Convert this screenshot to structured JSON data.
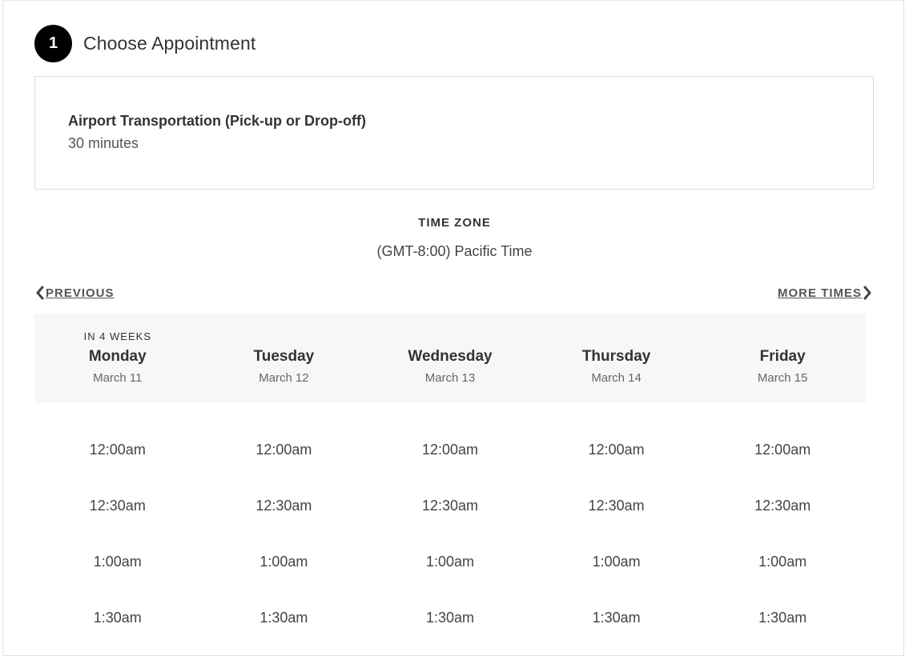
{
  "step": {
    "number": "1",
    "title": "Choose Appointment"
  },
  "service": {
    "name": "Airport Transportation (Pick-up or Drop-off)",
    "duration": "30 minutes"
  },
  "timezone": {
    "label": "TIME ZONE",
    "value": "(GMT-8:00) Pacific Time"
  },
  "nav": {
    "previous": "PREVIOUS",
    "more": "MORE TIMES"
  },
  "week_note": "IN 4 WEEKS",
  "days": [
    {
      "name": "Monday",
      "date": "March 11"
    },
    {
      "name": "Tuesday",
      "date": "March 12"
    },
    {
      "name": "Wednesday",
      "date": "March 13"
    },
    {
      "name": "Thursday",
      "date": "March 14"
    },
    {
      "name": "Friday",
      "date": "March 15"
    }
  ],
  "time_rows": [
    [
      "12:00am",
      "12:00am",
      "12:00am",
      "12:00am",
      "12:00am"
    ],
    [
      "12:30am",
      "12:30am",
      "12:30am",
      "12:30am",
      "12:30am"
    ],
    [
      "1:00am",
      "1:00am",
      "1:00am",
      "1:00am",
      "1:00am"
    ],
    [
      "1:30am",
      "1:30am",
      "1:30am",
      "1:30am",
      "1:30am"
    ]
  ]
}
